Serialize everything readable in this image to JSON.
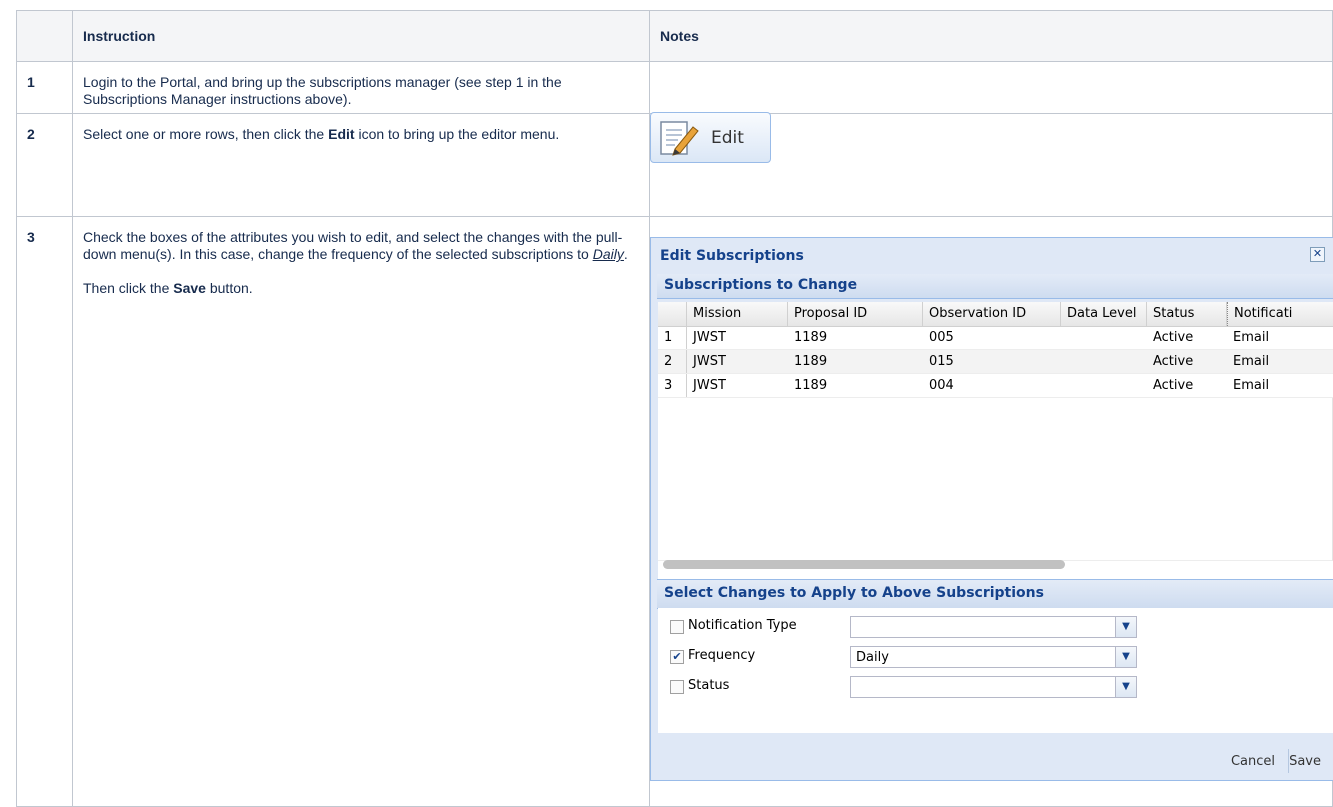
{
  "table": {
    "headers": [
      "",
      "Instruction",
      "Notes"
    ],
    "rows": [
      {
        "num": "1",
        "text": "Login to the Portal, and bring up the subscriptions manager (see step 1 in the Subscriptions Manager instructions above)."
      },
      {
        "num": "2",
        "text_pre": "Select one or more rows, then click the ",
        "text_bold": "Edit",
        "text_post": " icon to bring up the editor menu."
      },
      {
        "num": "3",
        "p1_pre": "Check the boxes of the attributes you wish to edit, and select the changes with the pull-down menu(s). In this case, change the frequency of the selected subscriptions to ",
        "p1_link": "Daily",
        "p1_post": ".",
        "p2_pre": "Then click the ",
        "p2_bold": "Save",
        "p2_post": " button."
      }
    ]
  },
  "edit_button": {
    "label": "Edit",
    "icon": "edit-document-pencil-icon"
  },
  "dialog": {
    "title": "Edit Subscriptions",
    "close_icon": "close-icon",
    "panel1_title": "Subscriptions to Change",
    "columns": [
      "Mission",
      "Proposal ID",
      "Observation ID",
      "Data Level",
      "Status",
      "Notificati"
    ],
    "rows": [
      {
        "n": "1",
        "cells": [
          "JWST",
          "1189",
          "005",
          "",
          "Active",
          "Email"
        ]
      },
      {
        "n": "2",
        "cells": [
          "JWST",
          "1189",
          "015",
          "",
          "Active",
          "Email"
        ]
      },
      {
        "n": "3",
        "cells": [
          "JWST",
          "1189",
          "004",
          "",
          "Active",
          "Email"
        ]
      }
    ],
    "panel2_title": "Select Changes to Apply to Above Subscriptions",
    "changes": [
      {
        "label": "Notification Type",
        "checked": false,
        "value": ""
      },
      {
        "label": "Frequency",
        "checked": true,
        "value": "Daily"
      },
      {
        "label": "Status",
        "checked": false,
        "value": ""
      }
    ],
    "cancel_label": "Cancel",
    "save_label": "Save"
  }
}
